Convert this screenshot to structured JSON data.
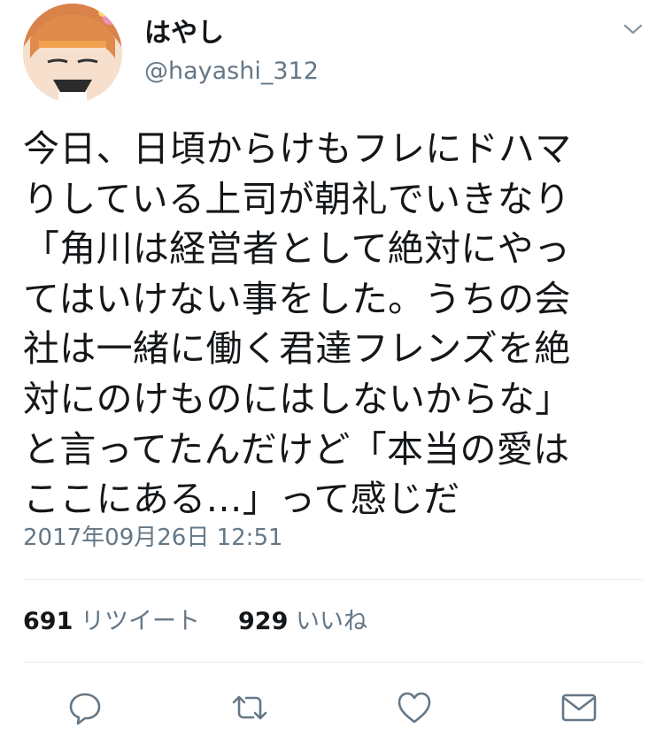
{
  "tweet": {
    "author": {
      "display_name": "はやし",
      "handle": "@hayashi_312"
    },
    "text_lines": [
      "今日、日頃からけもフレにドハマ",
      "りしている上司が朝礼でいきなり",
      "「角川は経営者として絶対にやっ",
      "てはいけない事をした。うちの会",
      "社は一緒に働く君達フレンズを絶",
      "対にのけものにはしないからな」",
      "と言ってたんだけど「本当の愛は",
      "ここにある…」って感じだ"
    ],
    "timestamp": "2017年09月26日 12:51",
    "stats": {
      "retweets_count": "691",
      "retweets_label": "リツイート",
      "likes_count": "929",
      "likes_label": "いいね"
    }
  },
  "icons": {
    "menu": "chevron-down-icon",
    "reply": "reply-icon",
    "retweet": "retweet-icon",
    "like": "heart-icon",
    "message": "envelope-icon"
  },
  "colors": {
    "text": "#14171a",
    "secondary": "#657786",
    "divider": "#e1e8ed",
    "icon": "#657786"
  }
}
